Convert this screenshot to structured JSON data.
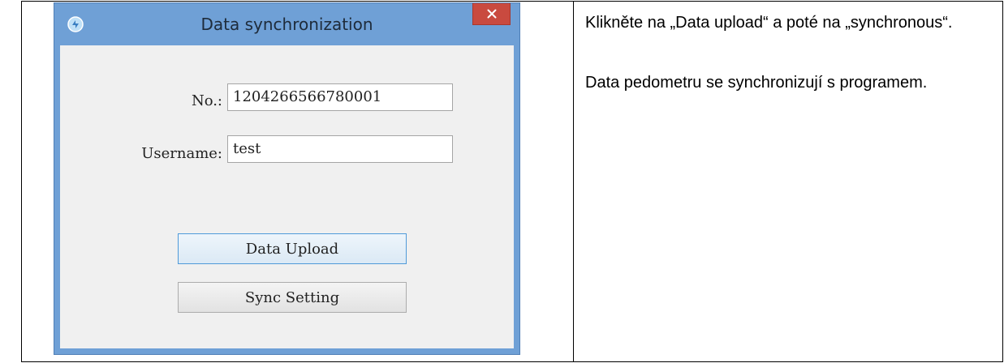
{
  "dialog": {
    "title": "Data synchronization",
    "close_label": "×",
    "fields": {
      "number_label": "No.:",
      "number_value": "1204266566780001",
      "username_label": "Username:",
      "username_value": "test"
    },
    "buttons": {
      "upload": "Data Upload",
      "sync": "Sync Setting"
    }
  },
  "instructions": {
    "paragraph_1": "Klikněte na „Data upload“ a poté na „synchronous“.",
    "paragraph_2": "Data pedometru se synchronizují s programem."
  },
  "colors": {
    "title_bar": "#6fa0d6",
    "close_button": "#c94a3f",
    "focus_border": "#4f9ad9"
  }
}
